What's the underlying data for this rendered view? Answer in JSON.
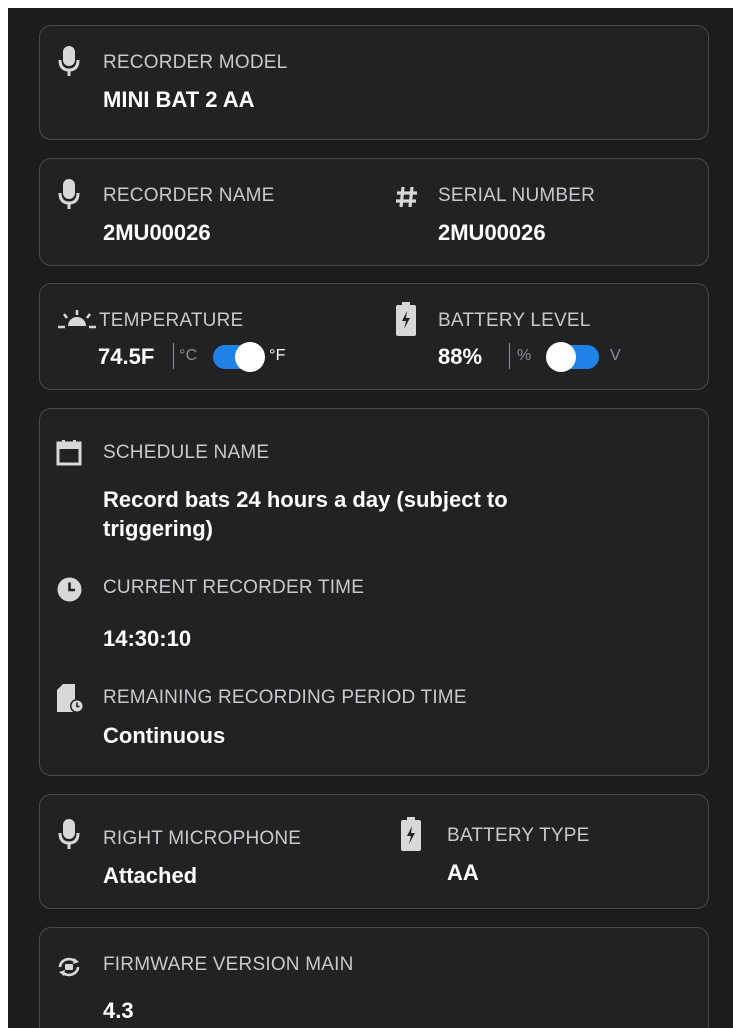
{
  "recorder_model": {
    "label": "RECORDER MODEL",
    "value": "MINI BAT 2 AA"
  },
  "recorder_name": {
    "label": "RECORDER NAME",
    "value": "2MU00026"
  },
  "serial_number": {
    "label": "SERIAL NUMBER",
    "value": "2MU00026"
  },
  "temperature": {
    "label": "TEMPERATURE",
    "value": "74.5F",
    "unit_left": "°C",
    "unit_right": "°F",
    "selected_unit": "°F"
  },
  "battery_level": {
    "label": "BATTERY LEVEL",
    "value": "88%",
    "unit_left": "%",
    "unit_right": "V",
    "selected_unit": "%"
  },
  "schedule": {
    "schedule_label": "SCHEDULE NAME",
    "schedule_value": "Record bats 24 hours a day (subject to triggering)",
    "time_label": "CURRENT RECORDER TIME",
    "time_value": "14:30:10",
    "remaining_label": "REMAINING RECORDING PERIOD TIME",
    "remaining_value": "Continuous"
  },
  "right_microphone": {
    "label": "RIGHT MICROPHONE",
    "value": "Attached"
  },
  "battery_type": {
    "label": "BATTERY TYPE",
    "value": "AA"
  },
  "firmware": {
    "label": "FIRMWARE VERSION MAIN",
    "value": "4.3"
  },
  "colors": {
    "background": "#1c1c1d",
    "card": "#222224",
    "card_border": "#4a4a4d",
    "toggle_accent": "#1f82e6"
  },
  "icons": [
    "mic-icon",
    "hash-icon",
    "sunrise-icon",
    "battery-icon",
    "calendar-icon",
    "clock-icon",
    "sd-card-clock-icon",
    "firmware-sync-icon"
  ]
}
